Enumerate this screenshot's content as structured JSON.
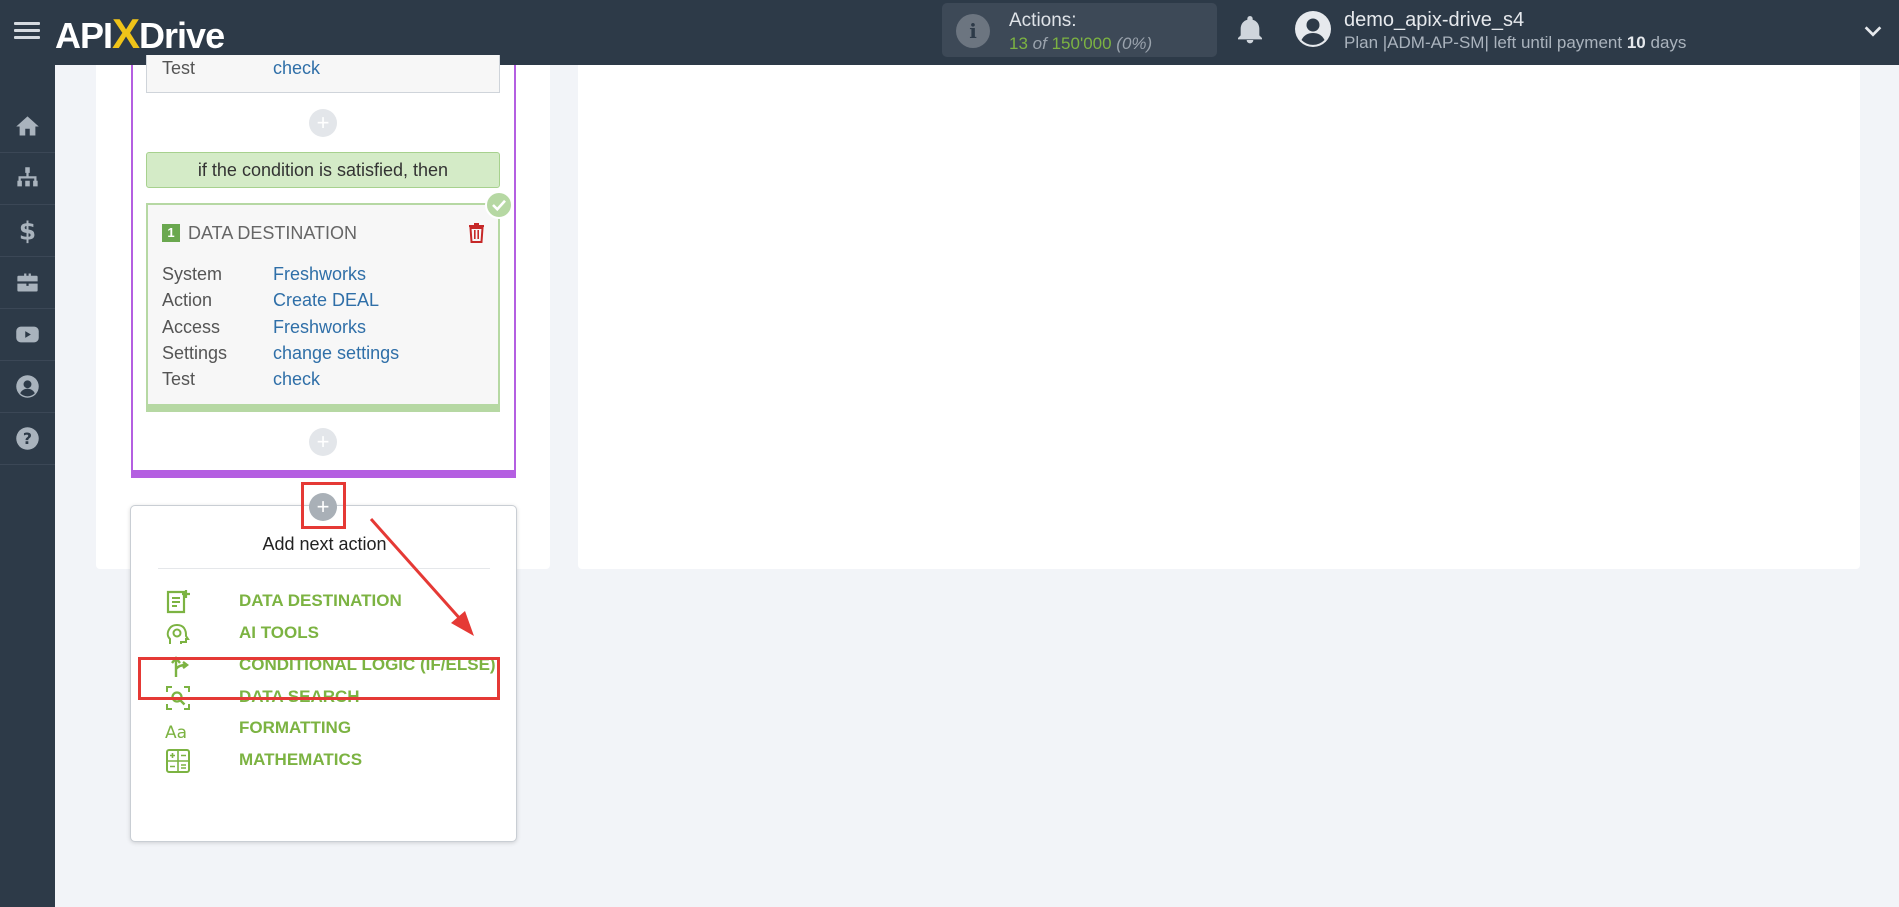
{
  "header": {
    "logo_text_api": "API",
    "logo_text_x": "X",
    "logo_text_drive": "Drive",
    "actions_label": "Actions:",
    "actions_used": "13",
    "actions_of": "of",
    "actions_total": "150'000",
    "actions_pct": "(0%)",
    "user_name": "demo_apix-drive_s4",
    "plan_text": "Plan |ADM-AP-SM| left until payment",
    "plan_days": "10",
    "plan_days_unit": "days"
  },
  "sidebar": {
    "items": [
      {
        "icon": "home-icon"
      },
      {
        "icon": "sitemap-icon"
      },
      {
        "icon": "dollar-icon"
      },
      {
        "icon": "briefcase-icon"
      },
      {
        "icon": "youtube-icon"
      },
      {
        "icon": "user-circle-icon"
      },
      {
        "icon": "help-icon"
      }
    ]
  },
  "flow": {
    "top_card": {
      "key": "Test",
      "value": "check"
    },
    "condition_text": "if the condition is satisfied, then",
    "destination": {
      "number": "1",
      "title": "DATA DESTINATION",
      "rows": [
        {
          "key": "System",
          "value": "Freshworks"
        },
        {
          "key": "Action",
          "value": "Create DEAL"
        },
        {
          "key": "Access",
          "value": "Freshworks"
        },
        {
          "key": "Settings",
          "value": "change settings"
        },
        {
          "key": "Test",
          "value": "check"
        }
      ]
    },
    "plus_symbol": "+"
  },
  "menu": {
    "title": "Add next action",
    "items": [
      {
        "label": "DATA DESTINATION",
        "icon": "data-destination-icon"
      },
      {
        "label": "AI TOOLS",
        "icon": "ai-tools-icon"
      },
      {
        "label": "CONDITIONAL LOGIC (IF/ELSE)",
        "icon": "conditional-logic-icon"
      },
      {
        "label": "DATA SEARCH",
        "icon": "data-search-icon"
      },
      {
        "label": "FORMATTING",
        "icon": "formatting-icon"
      },
      {
        "label": "MATHEMATICS",
        "icon": "mathematics-icon"
      }
    ]
  },
  "colors": {
    "topbar": "#2d3a48",
    "accent_green": "#7cb342",
    "purple": "#b45fe1",
    "highlight_red": "#e53935",
    "link_blue": "#2f6fa8"
  }
}
